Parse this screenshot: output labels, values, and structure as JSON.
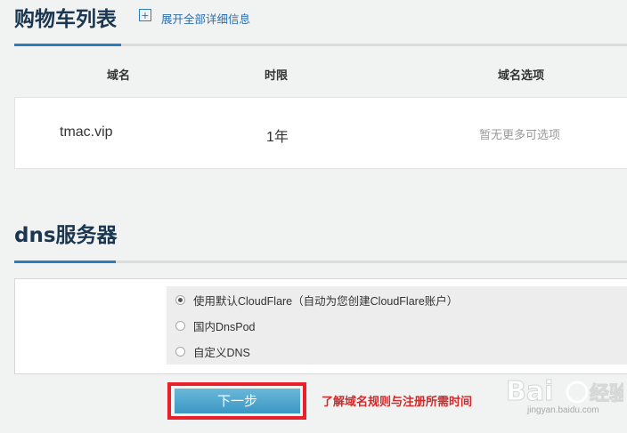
{
  "cart": {
    "title": "购物车列表",
    "expand_label": "展开全部详细信息",
    "columns": [
      "域名",
      "时限",
      "域名选项"
    ],
    "rows": [
      {
        "domain": "tmac.vip",
        "term": "1年",
        "options": "暂无更多可选项"
      }
    ]
  },
  "dns": {
    "title": "dns服务器",
    "options": [
      {
        "label": "使用默认CloudFlare（自动为您创建CloudFlare账户）",
        "selected": true
      },
      {
        "label": "国内DnsPod",
        "selected": false
      },
      {
        "label": "自定义DNS",
        "selected": false
      }
    ]
  },
  "actions": {
    "next_label": "下一步",
    "rules_link": "了解域名规则与注册所需时间"
  },
  "watermark": {
    "logo": "Baidu经验",
    "site": "jingyan.baidu.com"
  },
  "colors": {
    "accent": "#2a7ec0",
    "highlight_border": "#e8202a",
    "link_red": "#d02a2a"
  }
}
